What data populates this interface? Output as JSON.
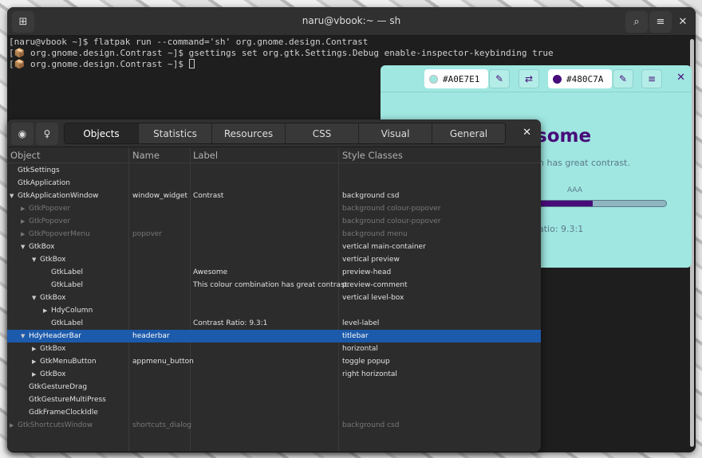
{
  "terminal": {
    "title": "naru@vbook:~ — sh",
    "lines": [
      {
        "prefix": "",
        "text": "[naru@vbook ~]$ flatpak run --command='sh' org.gnome.design.Contrast"
      },
      {
        "prefix": "[",
        "text": " org.gnome.design.Contrast ~]$ gsettings set org.gtk.Settings.Debug enable-inspector-keybinding true"
      },
      {
        "prefix": "[",
        "text": " org.gnome.design.Contrast ~]$ "
      }
    ],
    "icons": {
      "new_tab": "new-tab-icon",
      "search": "search-icon",
      "menu": "hamburger-menu-icon",
      "close": "close-icon"
    }
  },
  "contrast": {
    "bg_color": "#A0E7E1",
    "fg_color": "#480C7A",
    "bg_hex": "#A0E7E1",
    "fg_hex": "#480C7A",
    "head": "some",
    "comment": "n has great contrast.",
    "aaa": "AAA",
    "ratio": "atio: 9.3:1",
    "level_fraction": 0.45
  },
  "inspector": {
    "tabs": [
      "Objects",
      "Statistics",
      "Resources",
      "CSS",
      "Visual",
      "General"
    ],
    "active_tab": "Objects",
    "columns": [
      "Object",
      "Name",
      "Label",
      "Style Classes"
    ],
    "rows": [
      {
        "object": "GtkSettings",
        "name": "",
        "label": "",
        "style": "",
        "depth": 0,
        "exp": ""
      },
      {
        "object": "GtkApplication",
        "name": "",
        "label": "",
        "style": "",
        "depth": 0,
        "exp": ""
      },
      {
        "object": "GtkApplicationWindow",
        "name": "window_widget",
        "label": "Contrast",
        "style": "background csd",
        "depth": 0,
        "exp": "▼"
      },
      {
        "object": "GtkPopover",
        "name": "",
        "label": "",
        "style": "background colour-popover",
        "depth": 1,
        "exp": "▶",
        "dim": true
      },
      {
        "object": "GtkPopover",
        "name": "",
        "label": "",
        "style": "background colour-popover",
        "depth": 1,
        "exp": "▶",
        "dim": true
      },
      {
        "object": "GtkPopoverMenu",
        "name": "popover",
        "label": "",
        "style": "background menu",
        "depth": 1,
        "exp": "▶",
        "dim": true
      },
      {
        "object": "GtkBox",
        "name": "",
        "label": "",
        "style": "vertical main-container",
        "depth": 1,
        "exp": "▼"
      },
      {
        "object": "GtkBox",
        "name": "",
        "label": "",
        "style": "vertical preview",
        "depth": 2,
        "exp": "▼"
      },
      {
        "object": "GtkLabel",
        "name": "",
        "label": "Awesome",
        "style": "preview-head",
        "depth": 3,
        "exp": ""
      },
      {
        "object": "GtkLabel",
        "name": "",
        "label": "This colour combination has great contrast.",
        "style": "preview-comment",
        "depth": 3,
        "exp": ""
      },
      {
        "object": "GtkBox",
        "name": "",
        "label": "",
        "style": "vertical level-box",
        "depth": 2,
        "exp": "▼"
      },
      {
        "object": "HdyColumn",
        "name": "",
        "label": "",
        "style": "",
        "depth": 3,
        "exp": "▶"
      },
      {
        "object": "GtkLabel",
        "name": "",
        "label": "Contrast Ratio: 9.3:1",
        "style": "level-label",
        "depth": 3,
        "exp": ""
      },
      {
        "object": "HdyHeaderBar",
        "name": "headerbar",
        "label": "",
        "style": "titlebar",
        "depth": 1,
        "exp": "▼",
        "sel": true
      },
      {
        "object": "GtkBox",
        "name": "",
        "label": "",
        "style": "horizontal",
        "depth": 2,
        "exp": "▶"
      },
      {
        "object": "GtkMenuButton",
        "name": "appmenu_button",
        "label": "",
        "style": "toggle popup",
        "depth": 2,
        "exp": "▶"
      },
      {
        "object": "GtkBox",
        "name": "",
        "label": "",
        "style": "right horizontal",
        "depth": 2,
        "exp": "▶"
      },
      {
        "object": "GtkGestureDrag",
        "name": "",
        "label": "",
        "style": "",
        "depth": 1,
        "exp": ""
      },
      {
        "object": "GtkGestureMultiPress",
        "name": "",
        "label": "",
        "style": "",
        "depth": 1,
        "exp": ""
      },
      {
        "object": "GdkFrameClockIdle",
        "name": "",
        "label": "",
        "style": "",
        "depth": 1,
        "exp": ""
      },
      {
        "object": "GtkShortcutsWindow",
        "name": "shortcuts_dialog",
        "label": "",
        "style": "background csd",
        "depth": 0,
        "exp": "▶",
        "dim": true
      }
    ]
  }
}
